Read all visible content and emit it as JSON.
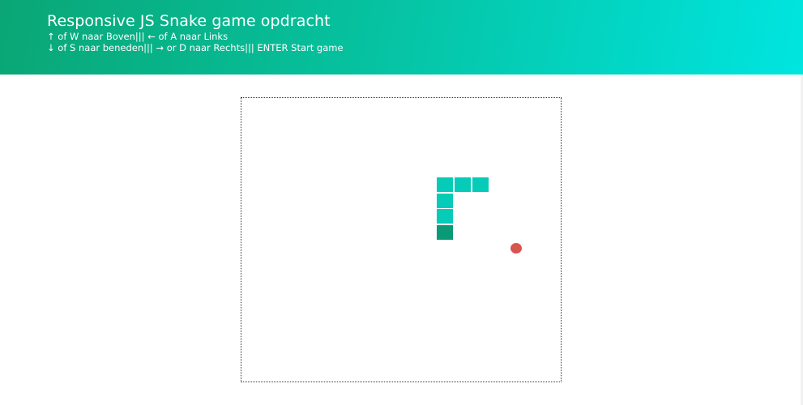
{
  "header": {
    "title": "Responsive JS Snake game opdracht",
    "controls_line1": "↑ of W naar Boven||| ← of A naar Links",
    "controls_line2": "↓ of S naar beneden||| → or D naar Rechts||| ENTER Start game"
  },
  "game": {
    "snake_color": "#06cbb8",
    "snake_head_color": "#0a9a76",
    "food_color": "#d9534f",
    "snake_segments": [
      {
        "col": 0,
        "row": 0
      },
      {
        "col": 1,
        "row": 0
      },
      {
        "col": 2,
        "row": 0
      },
      {
        "col": 0,
        "row": 1
      },
      {
        "col": 0,
        "row": 2
      },
      {
        "col": 0,
        "row": 3,
        "head": true
      }
    ]
  }
}
